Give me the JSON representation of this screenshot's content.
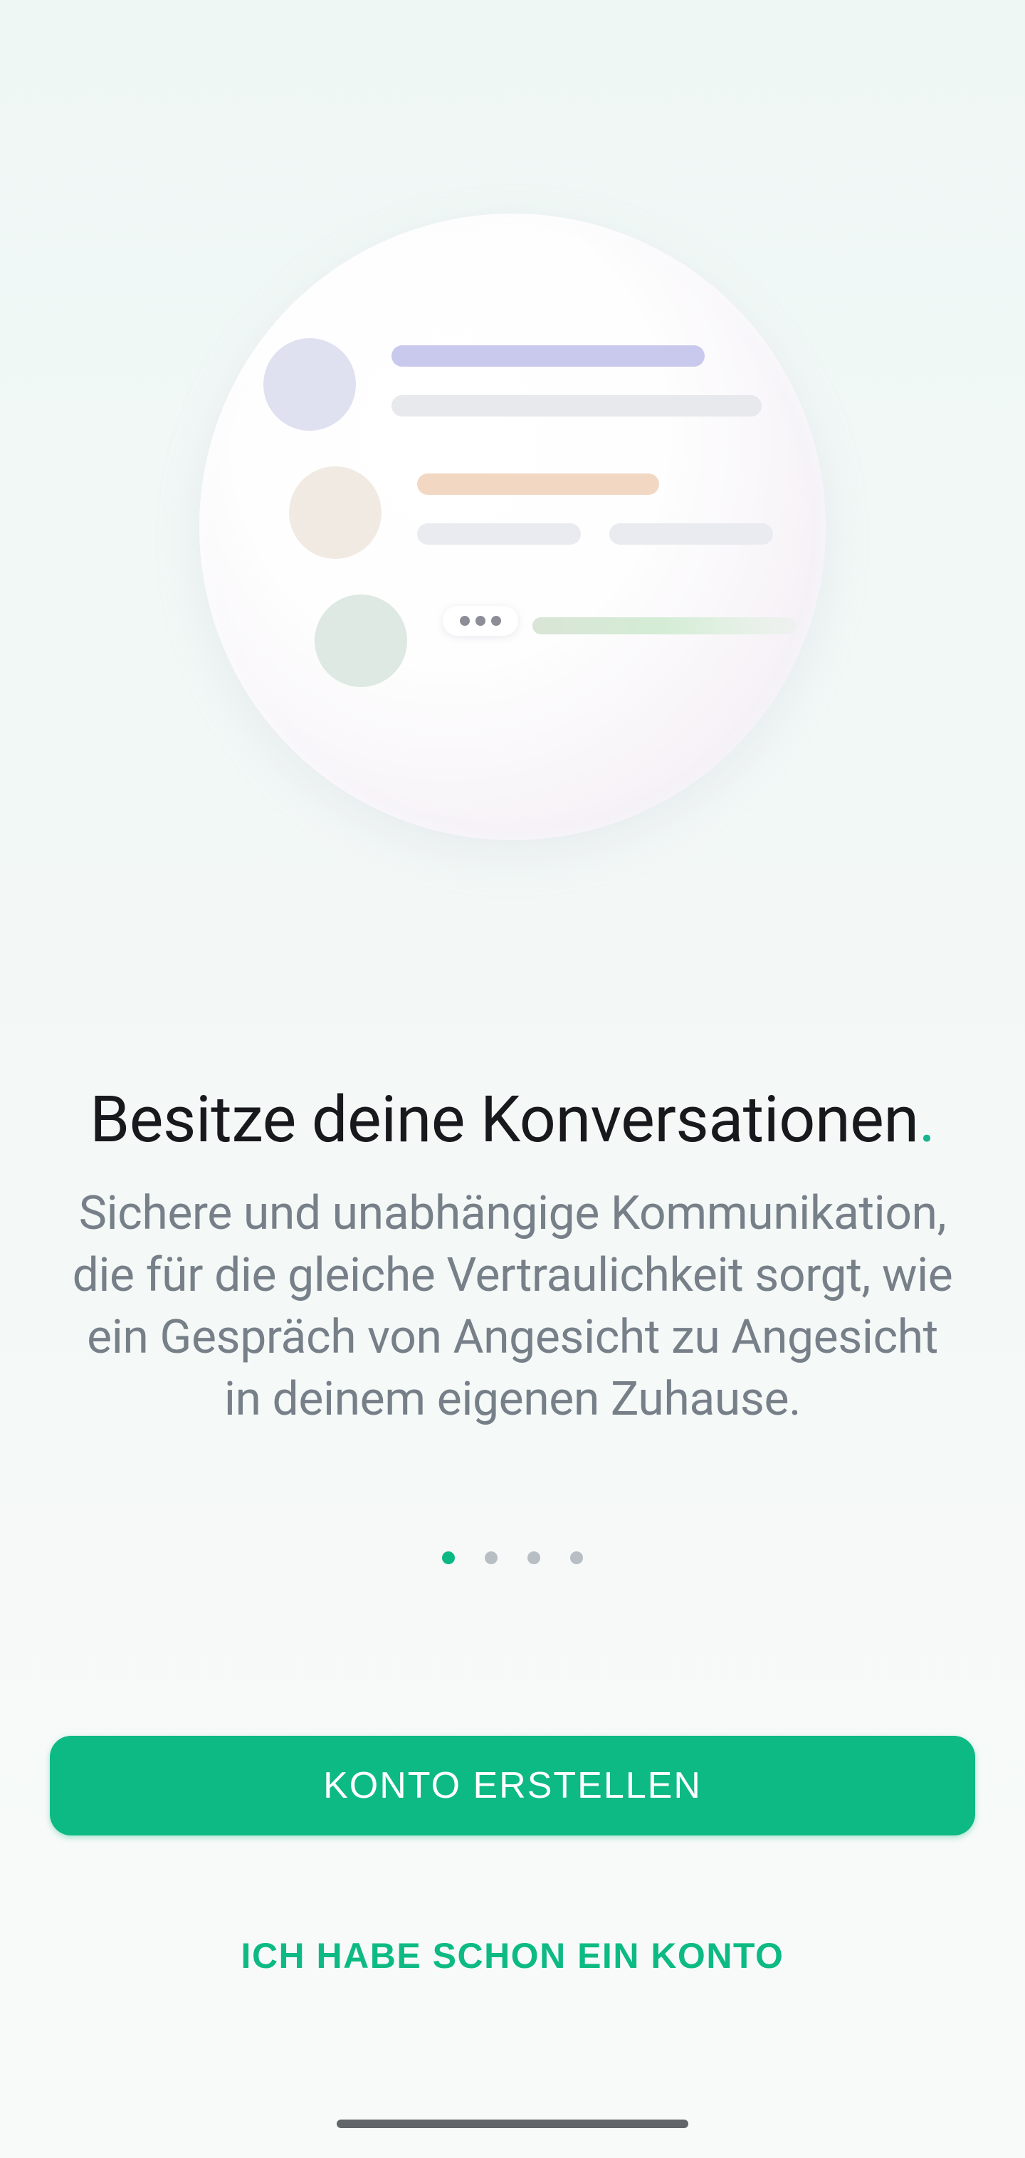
{
  "onboarding": {
    "headline": "Besitze deine Konversationen",
    "headline_punct": ".",
    "subtext": "Sichere und unabhängige Kommunikation, die für die gleiche Vertraulichkeit sorgt, wie ein Gespräch von Angesicht zu Angesicht in deinem eigenen Zuhause.",
    "pages_total": 4,
    "current_page": 1
  },
  "buttons": {
    "create_account": "KONTO ERSTELLEN",
    "existing_account": "ICH HABE SCHON EIN KONTO"
  }
}
